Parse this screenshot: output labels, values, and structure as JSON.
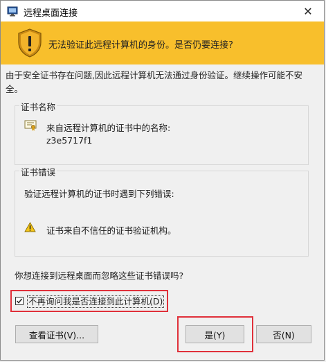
{
  "window": {
    "title": "远程桌面连接",
    "close_glyph": "✕"
  },
  "banner": {
    "message": "无法验证此远程计算机的身份。是否仍要连接?"
  },
  "description": "由于安全证书存在问题,因此远程计算机无法通过身份验证。继续操作可能不安全。",
  "cert_name_group": {
    "legend": "证书名称",
    "from_label": "来自远程计算机的证书中的名称:",
    "name_value": "z3e5717f1"
  },
  "cert_error_group": {
    "legend": "证书错误",
    "intro": "验证远程计算机的证书时遇到下列错误:",
    "error_item": "证书来自不信任的证书验证机构。"
  },
  "question": "你想连接到远程桌面而忽略这些证书错误吗?",
  "checkbox": {
    "label": "不再询问我是否连接到此计算机(D)",
    "checked": true
  },
  "buttons": {
    "view_cert": "查看证书(V)...",
    "yes": "是(Y)",
    "no": "否(N)"
  },
  "colors": {
    "banner": "#f8bf2c",
    "highlight": "#e0303a"
  },
  "icons": {
    "app": "remote-desktop-icon",
    "banner": "warning-shield-icon",
    "cert": "certificate-icon",
    "warn": "warning-triangle-icon"
  }
}
